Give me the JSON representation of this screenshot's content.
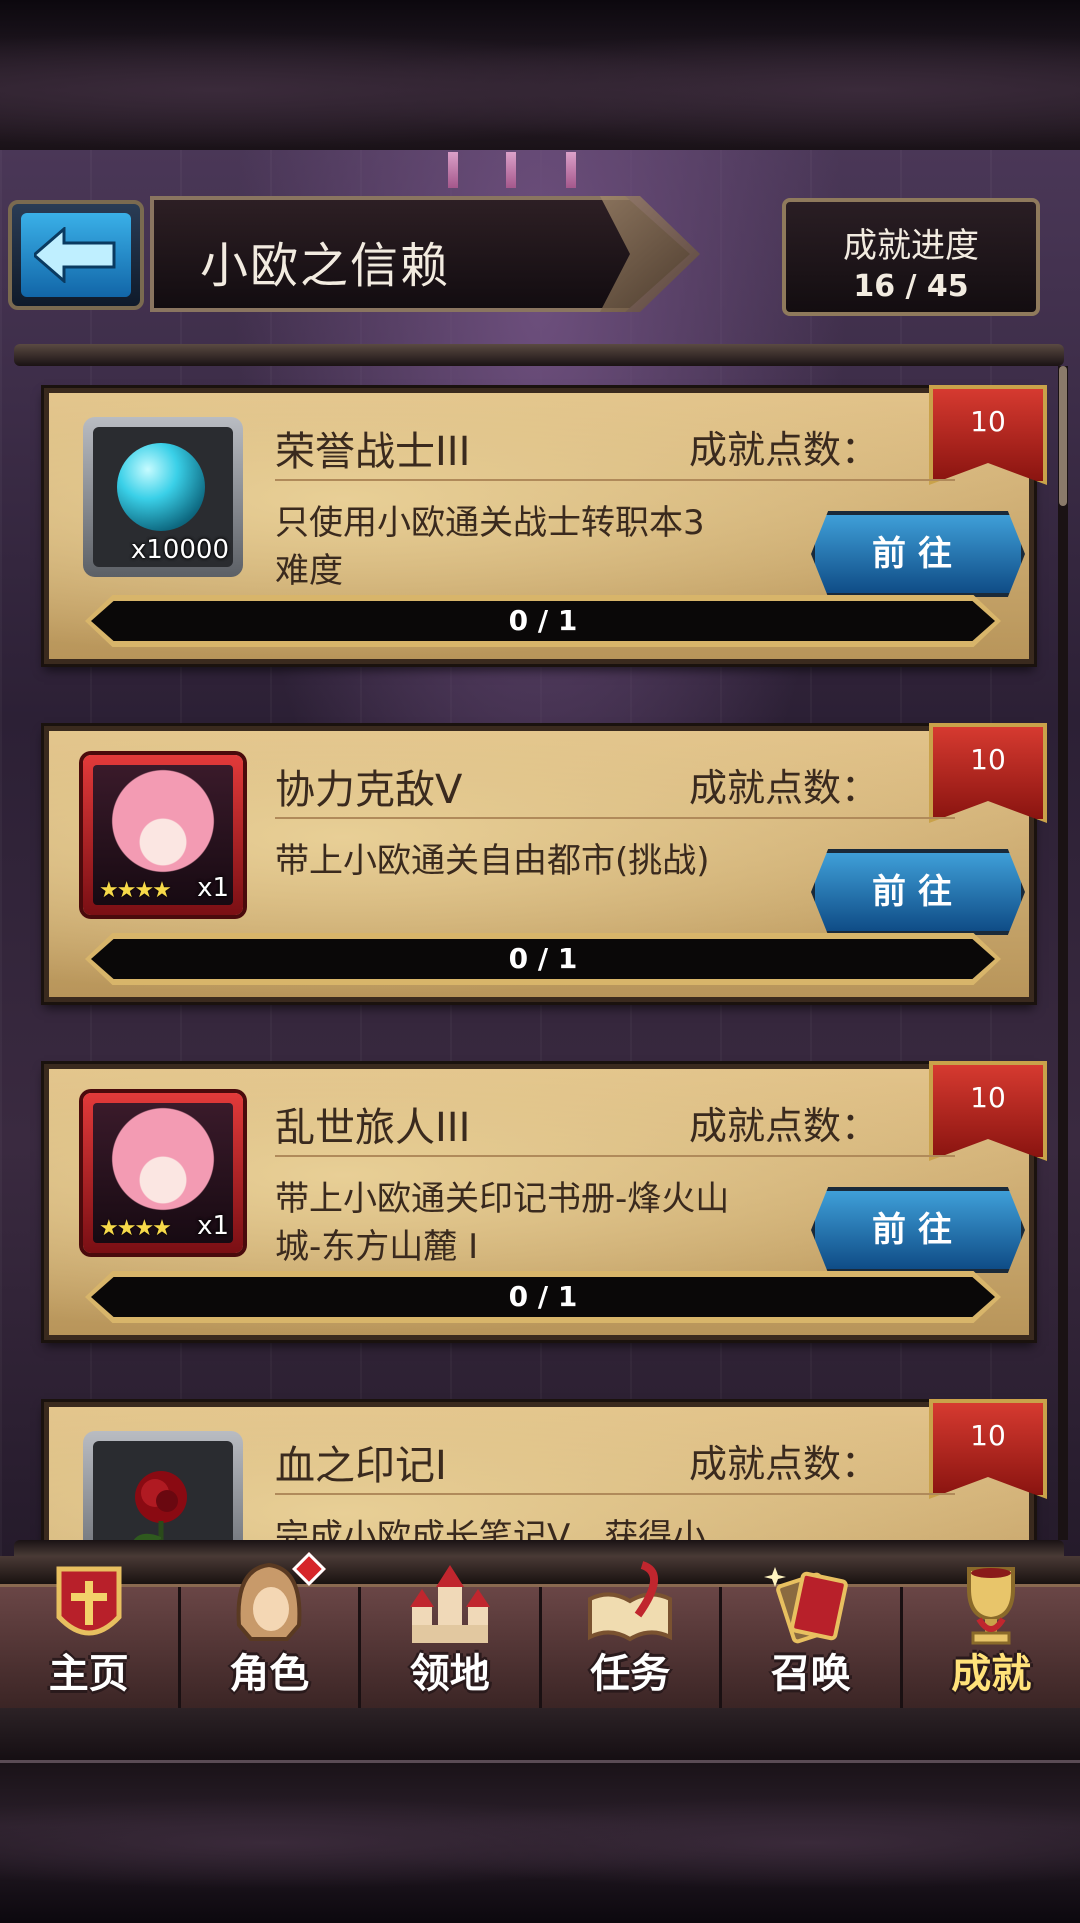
{
  "header": {
    "title": "小欧之信赖",
    "progress_label": "成就进度",
    "progress_value": "16 / 45"
  },
  "achievements": [
    {
      "name": "荣誉战士III",
      "points_label": "成就点数：",
      "points": "10",
      "description": "只使用小欧通关战士转职本3难度",
      "reward_qty": "x10000",
      "reward_stars": "",
      "progress": "0 / 1",
      "button": "前往",
      "icon": "orb-icon"
    },
    {
      "name": "协力克敌V",
      "points_label": "成就点数：",
      "points": "10",
      "description": "带上小欧通关自由都市(挑战)",
      "reward_qty": "x1",
      "reward_stars": "★★★★",
      "progress": "0 / 1",
      "button": "前往",
      "icon": "character-portrait-icon"
    },
    {
      "name": "乱世旅人III",
      "points_label": "成就点数：",
      "points": "10",
      "description": "带上小欧通关印记书册-烽火山城-东方山麓 I",
      "reward_qty": "x1",
      "reward_stars": "★★★★",
      "progress": "0 / 1",
      "button": "前往",
      "icon": "character-portrait-icon"
    },
    {
      "name": "血之印记I",
      "points_label": "成就点数：",
      "points": "10",
      "description": "完成小欧成长笔记V，获得小",
      "reward_qty": "",
      "reward_stars": "",
      "progress": "",
      "button": "",
      "icon": "rose-icon"
    }
  ],
  "nav": [
    {
      "label": "主页",
      "icon": "home-shield-icon"
    },
    {
      "label": "角色",
      "icon": "hooded-character-icon"
    },
    {
      "label": "领地",
      "icon": "castle-icon"
    },
    {
      "label": "任务",
      "icon": "quest-book-icon"
    },
    {
      "label": "召唤",
      "icon": "summon-cards-icon"
    },
    {
      "label": "成就",
      "icon": "trophy-icon"
    }
  ],
  "colors": {
    "accent_gold": "#ffe27a",
    "ribbon_red": "#d63a30",
    "button_blue": "#3f9fd8",
    "card_parchment": "#e2c38a"
  }
}
